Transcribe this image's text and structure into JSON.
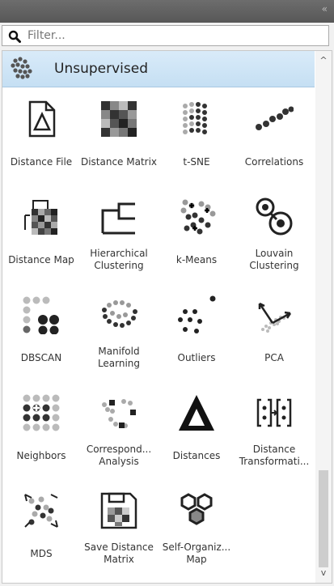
{
  "header": {
    "collapse_label": "«"
  },
  "filter": {
    "placeholder": "Filter...",
    "value": ""
  },
  "category": {
    "title": "Unsupervised"
  },
  "scrollbar": {
    "up": "^",
    "down": "v"
  },
  "widgets": [
    {
      "label": "Distance File",
      "icon": "distance-file-icon"
    },
    {
      "label": "Distance Matrix",
      "icon": "distance-matrix-icon"
    },
    {
      "label": "t-SNE",
      "icon": "t-sne-icon"
    },
    {
      "label": "Correlations",
      "icon": "correlations-icon"
    },
    {
      "label": "Distance Map",
      "icon": "distance-map-icon"
    },
    {
      "label": "Hierarchical Clustering",
      "icon": "hierarchical-clustering-icon"
    },
    {
      "label": "k-Means",
      "icon": "k-means-icon"
    },
    {
      "label": "Louvain Clustering",
      "icon": "louvain-clustering-icon"
    },
    {
      "label": "DBSCAN",
      "icon": "dbscan-icon"
    },
    {
      "label": "Manifold Learning",
      "icon": "manifold-learning-icon"
    },
    {
      "label": "Outliers",
      "icon": "outliers-icon"
    },
    {
      "label": "PCA",
      "icon": "pca-icon"
    },
    {
      "label": "Neighbors",
      "icon": "neighbors-icon"
    },
    {
      "label": "Correspond... Analysis",
      "icon": "correspondence-analysis-icon"
    },
    {
      "label": "Distances",
      "icon": "distances-icon"
    },
    {
      "label": "Distance Transformati...",
      "icon": "distance-transformation-icon"
    },
    {
      "label": "MDS",
      "icon": "mds-icon"
    },
    {
      "label": "Save Distance Matrix",
      "icon": "save-distance-matrix-icon"
    },
    {
      "label": "Self-Organiz... Map",
      "icon": "self-organizing-map-icon"
    }
  ]
}
